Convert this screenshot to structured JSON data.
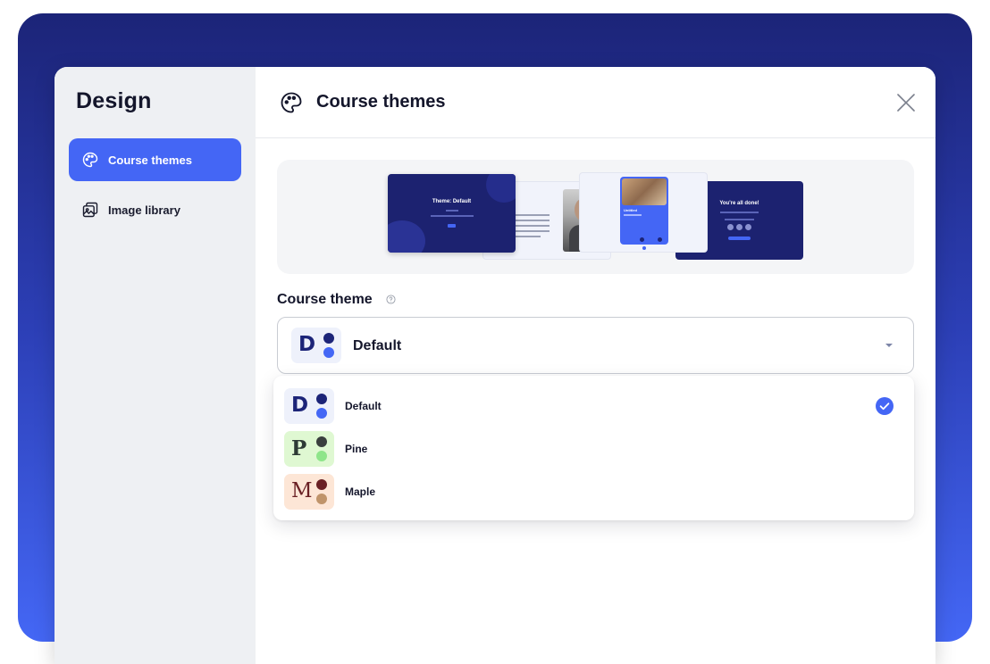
{
  "sidebar": {
    "title": "Design",
    "items": [
      {
        "label": "Course themes",
        "icon": "palette-icon",
        "active": true
      },
      {
        "label": "Image library",
        "icon": "image-stack-icon",
        "active": false
      }
    ]
  },
  "header": {
    "title": "Course themes",
    "icon": "palette-icon",
    "close_icon": "close-icon"
  },
  "preview": {
    "slides": [
      {
        "title": "Theme: Default"
      },
      {
        "title": "Untitled"
      },
      {
        "title": "You're all done!"
      }
    ]
  },
  "theme_field": {
    "label": "Course theme",
    "info_icon": "info-icon",
    "selected": {
      "letter": "D",
      "name": "Default"
    }
  },
  "options": [
    {
      "letter": "D",
      "name": "Default",
      "selected": true,
      "bg": "#eef1fb",
      "letter_color": "#1c2478",
      "dot1": "#1c2478",
      "dot2": "#4467f5"
    },
    {
      "letter": "P",
      "name": "Pine",
      "selected": false,
      "bg": "#dff8d2",
      "letter_color": "#2d3a35",
      "dot1": "#3a3f3e",
      "dot2": "#8ee58a"
    },
    {
      "letter": "M",
      "name": "Maple",
      "selected": false,
      "bg": "#fde6d6",
      "letter_color": "#6a2024",
      "dot1": "#6a2024",
      "dot2": "#c0946a"
    }
  ],
  "colors": {
    "accent": "#4466f5",
    "navy": "#1c2478"
  }
}
